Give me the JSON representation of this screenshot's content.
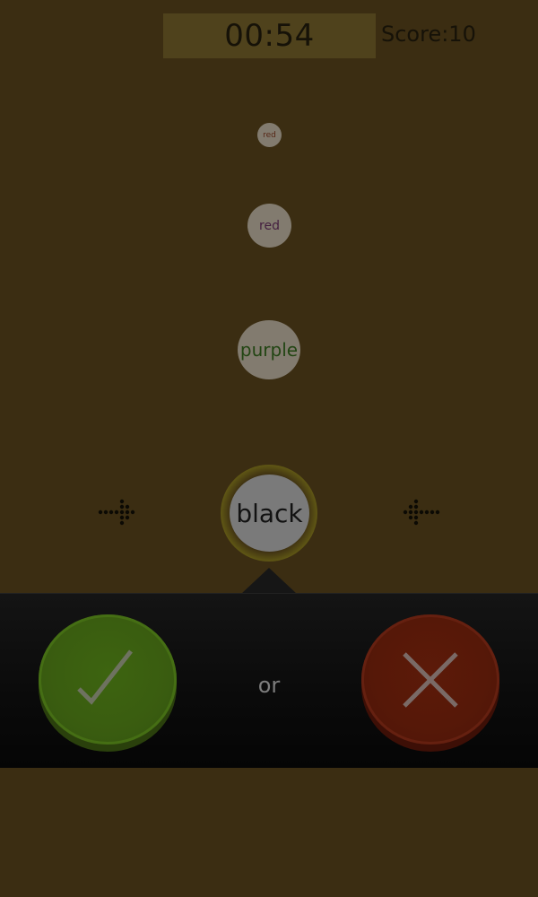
{
  "header": {
    "timer": "00:54",
    "score": "Score:10"
  },
  "words": [
    {
      "text": "red",
      "color": "#a0281e"
    },
    {
      "text": "red",
      "color": "#6e1e8c"
    },
    {
      "text": "purple",
      "color": "#1e8c1e"
    }
  ],
  "current_word": {
    "text": "black",
    "color": "#121212"
  },
  "icons": {
    "left": "dotted-arrow-right-icon",
    "right": "dotted-arrow-left-icon",
    "yes": "checkmark-icon",
    "no": "cross-icon"
  },
  "answer_panel": {
    "or_label": "or"
  },
  "colors": {
    "background": "#3b2d12",
    "yes_button": "#3a5d10",
    "no_button": "#561808"
  }
}
